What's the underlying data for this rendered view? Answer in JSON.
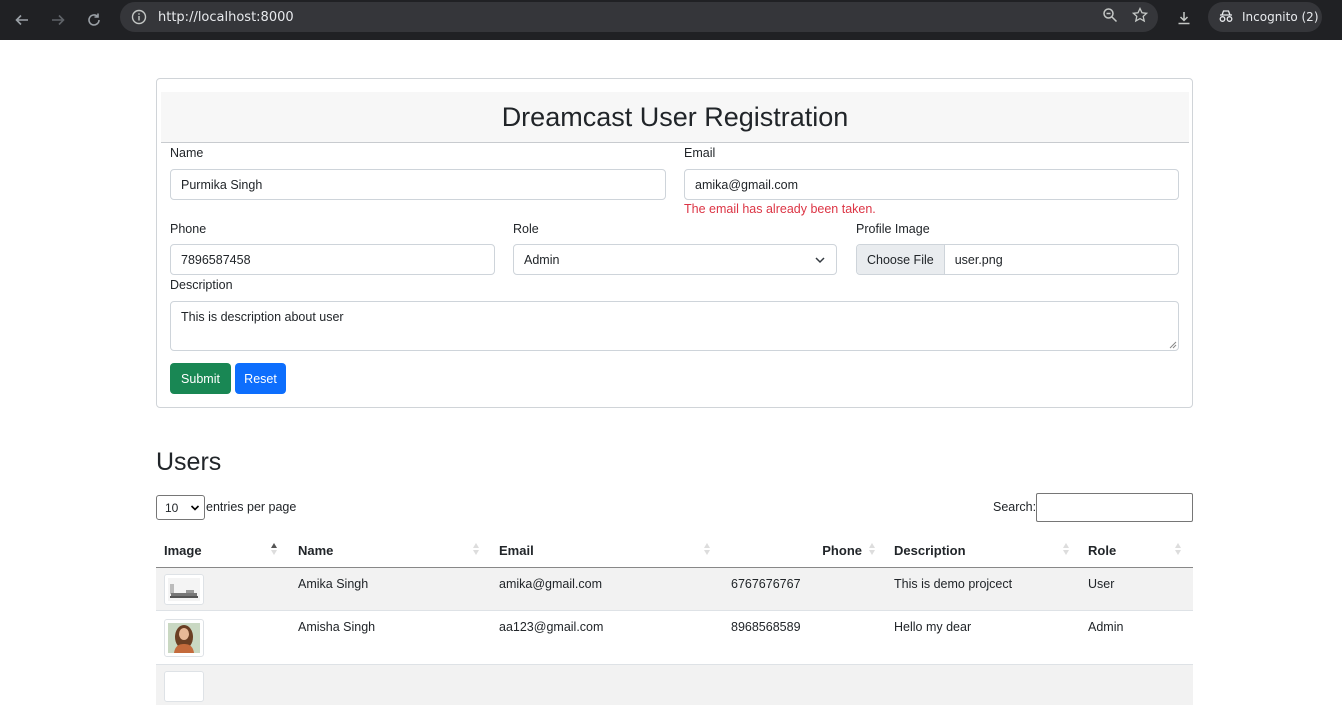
{
  "browser": {
    "url": "http://localhost:8000",
    "incognito_label": "Incognito (2)"
  },
  "form": {
    "title": "Dreamcast User Registration",
    "name_label": "Name",
    "name_value": "Purmika Singh",
    "email_label": "Email",
    "email_value": "amika@gmail.com",
    "email_error": "The email has already been taken.",
    "phone_label": "Phone",
    "phone_value": "7896587458",
    "role_label": "Role",
    "role_value": "Admin",
    "image_label": "Profile Image",
    "file_button": "Choose File",
    "file_name": "user.png",
    "description_label": "Description",
    "description_value": "This is description about user",
    "submit_label": "Submit",
    "reset_label": "Reset",
    "colors": {
      "submit": "#198754",
      "reset": "#0d6efd",
      "error": "#dc3545"
    }
  },
  "users": {
    "title": "Users",
    "per_page_value": "10",
    "per_page_label": "entries per page",
    "search_label": "Search:",
    "columns": [
      "Image",
      "Name",
      "Email",
      "Phone",
      "Description",
      "Role"
    ],
    "rows": [
      {
        "image": "thumbnail-landscape",
        "name": "Amika Singh",
        "email": "amika@gmail.com",
        "phone": "6767676767",
        "description": "This is demo projcect",
        "role": "User"
      },
      {
        "image": "thumbnail-portrait",
        "name": "Amisha Singh",
        "email": "aa123@gmail.com",
        "phone": "8968568589",
        "description": "Hello my dear",
        "role": "Admin"
      }
    ]
  }
}
